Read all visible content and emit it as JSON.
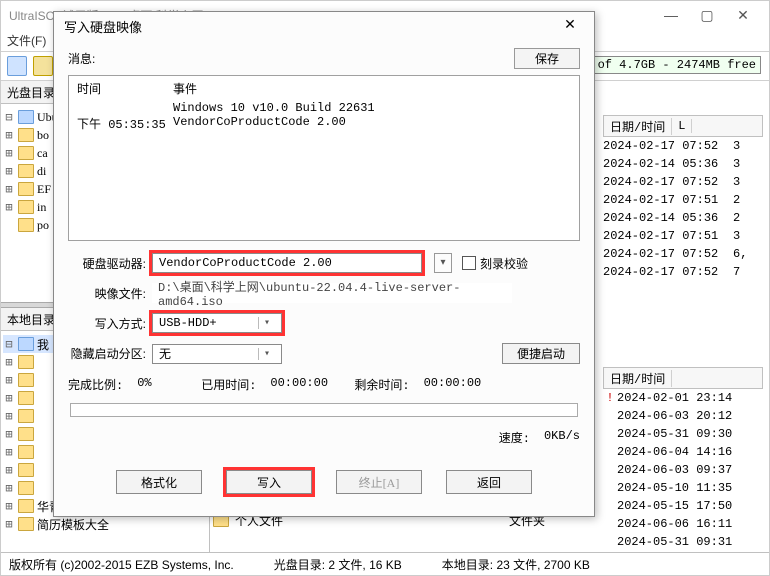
{
  "window": {
    "title": "UltraISO (试用版) - D:\\桌面\\科学上网\\ubuntu-22.04.4-live-server-amd64.iso",
    "min": "—",
    "max": "▢",
    "close": "✕"
  },
  "menu": {
    "file": "文件(F)"
  },
  "left_pane1_header": "光盘目录",
  "left_pane2_header": "本地目录",
  "capacity": "% of 4.7GB - 2474MB free",
  "tree1": {
    "root": "Ubunt",
    "items": [
      "bo",
      "ca",
      "di",
      "EF",
      "in",
      "po"
    ]
  },
  "tree2": {
    "root": "我",
    "items": [
      "",
      "",
      "",
      "",
      "",
      "",
      "",
      "",
      "华青",
      "简历模板大全"
    ]
  },
  "list_right_top": {
    "hdr_date": "日期/时间",
    "hdr_l": "L",
    "rows": [
      {
        "d": "2024-02-17 07:52",
        "v": "3"
      },
      {
        "d": "2024-02-14 05:36",
        "v": "3"
      },
      {
        "d": "2024-02-17 07:52",
        "v": "3"
      },
      {
        "d": "2024-02-17 07:51",
        "v": "2"
      },
      {
        "d": "2024-02-14 05:36",
        "v": "2"
      },
      {
        "d": "2024-02-17 07:51",
        "v": "3"
      },
      {
        "d": "2024-02-17 07:52",
        "v": "6,"
      },
      {
        "d": "2024-02-17 07:52",
        "v": "7"
      }
    ]
  },
  "list_right_bot": {
    "hdr_date": "日期/时间",
    "rows": [
      {
        "x": "!",
        "d": "2024-02-01 23:14"
      },
      {
        "x": "",
        "d": "2024-06-03 20:12"
      },
      {
        "x": "",
        "d": "2024-05-31 09:30"
      },
      {
        "x": "",
        "d": "2024-06-04 14:16"
      },
      {
        "x": "",
        "d": "2024-06-03 09:37"
      },
      {
        "x": "",
        "d": "2024-05-10 11:35"
      },
      {
        "x": "",
        "d": "2024-05-15 17:50"
      },
      {
        "x": "",
        "d": "2024-06-06 16:11"
      },
      {
        "x": "",
        "d": "2024-05-31 09:31"
      }
    ]
  },
  "bot_rows": [
    {
      "name": "个人文件",
      "type": "文件夹"
    }
  ],
  "status": {
    "copyright": "版权所有 (c)2002-2015 EZB Systems, Inc.",
    "discdir": "光盘目录: 2 文件, 16 KB",
    "localdir": "本地目录: 23 文件, 2700 KB"
  },
  "dialog": {
    "title": "写入硬盘映像",
    "close": "✕",
    "msg_label": "消息:",
    "save": "保存",
    "log_hdr_time": "时间",
    "log_hdr_event": "事件",
    "log": [
      {
        "t": "",
        "e": "Windows 10 v10.0 Build 22631"
      },
      {
        "t": "下午 05:35:35",
        "e": "VendorCoProductCode     2.00"
      }
    ],
    "drive_label": "硬盘驱动器:",
    "drive_value": "VendorCoProductCode    2.00",
    "verify_label": "刻录校验",
    "image_label": "映像文件:",
    "image_value": "D:\\桌面\\科学上网\\ubuntu-22.04.4-live-server-amd64.iso",
    "method_label": "写入方式:",
    "method_value": "USB-HDD+",
    "hidden_label": "隐藏启动分区:",
    "hidden_value": "无",
    "quick": "便捷启动",
    "pct_label": "完成比例:",
    "pct_value": "0%",
    "elapsed_label": "已用时间:",
    "elapsed_value": "00:00:00",
    "remain_label": "剩余时间:",
    "remain_value": "00:00:00",
    "speed_label": "速度:",
    "speed_value": "0KB/s",
    "btn_format": "格式化",
    "btn_write": "写入",
    "btn_abort": "终止[A]",
    "btn_back": "返回"
  }
}
